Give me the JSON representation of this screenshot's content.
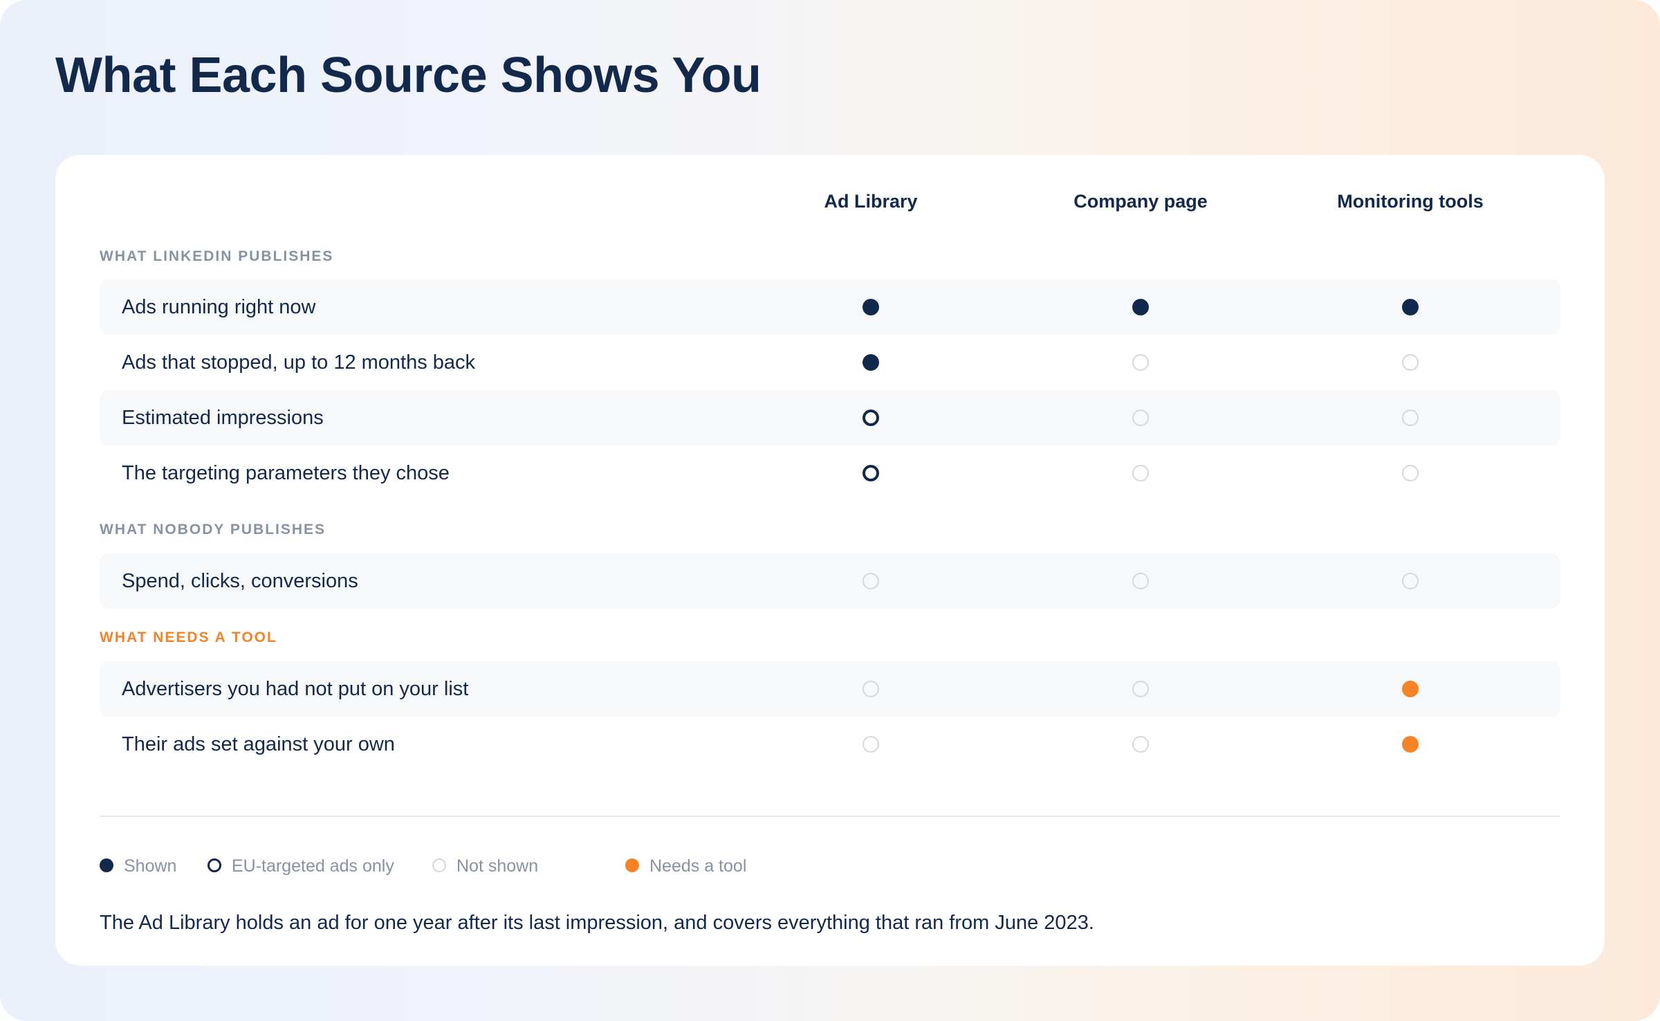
{
  "title": "What Each Source Shows You",
  "columns": [
    "Ad Library",
    "Company page",
    "Monitoring tools"
  ],
  "sections": [
    {
      "label": "WHAT LINKEDIN PUBLISHES",
      "accent": false,
      "rows": [
        {
          "label": "Ads running right now",
          "values": [
            "shown",
            "shown",
            "shown"
          ]
        },
        {
          "label": "Ads that stopped, up to 12 months back",
          "values": [
            "shown",
            "not",
            "not"
          ]
        },
        {
          "label": "Estimated impressions",
          "values": [
            "eu",
            "not",
            "not"
          ]
        },
        {
          "label": "The targeting parameters they chose",
          "values": [
            "eu",
            "not",
            "not"
          ]
        }
      ]
    },
    {
      "label": "WHAT NOBODY PUBLISHES",
      "accent": false,
      "rows": [
        {
          "label": "Spend, clicks, conversions",
          "values": [
            "not",
            "not",
            "not"
          ]
        }
      ]
    },
    {
      "label": "WHAT NEEDS A TOOL",
      "accent": true,
      "rows": [
        {
          "label": "Advertisers you had not put on your list",
          "values": [
            "not",
            "not",
            "tool"
          ]
        },
        {
          "label": "Their ads set against your own",
          "values": [
            "not",
            "not",
            "tool"
          ]
        }
      ]
    }
  ],
  "legend": [
    {
      "key": "shown",
      "label": "Shown"
    },
    {
      "key": "eu",
      "label": "EU-targeted ads only"
    },
    {
      "key": "not",
      "label": "Not shown"
    },
    {
      "key": "tool",
      "label": "Needs a tool"
    }
  ],
  "footnote": "The Ad Library holds an ad for one year after its last impression, and covers everything that ran from June 2023.",
  "colors": {
    "navy": "#13294b",
    "orange": "#f48426",
    "muted": "#8792a3",
    "empty": "#d3d8df"
  }
}
